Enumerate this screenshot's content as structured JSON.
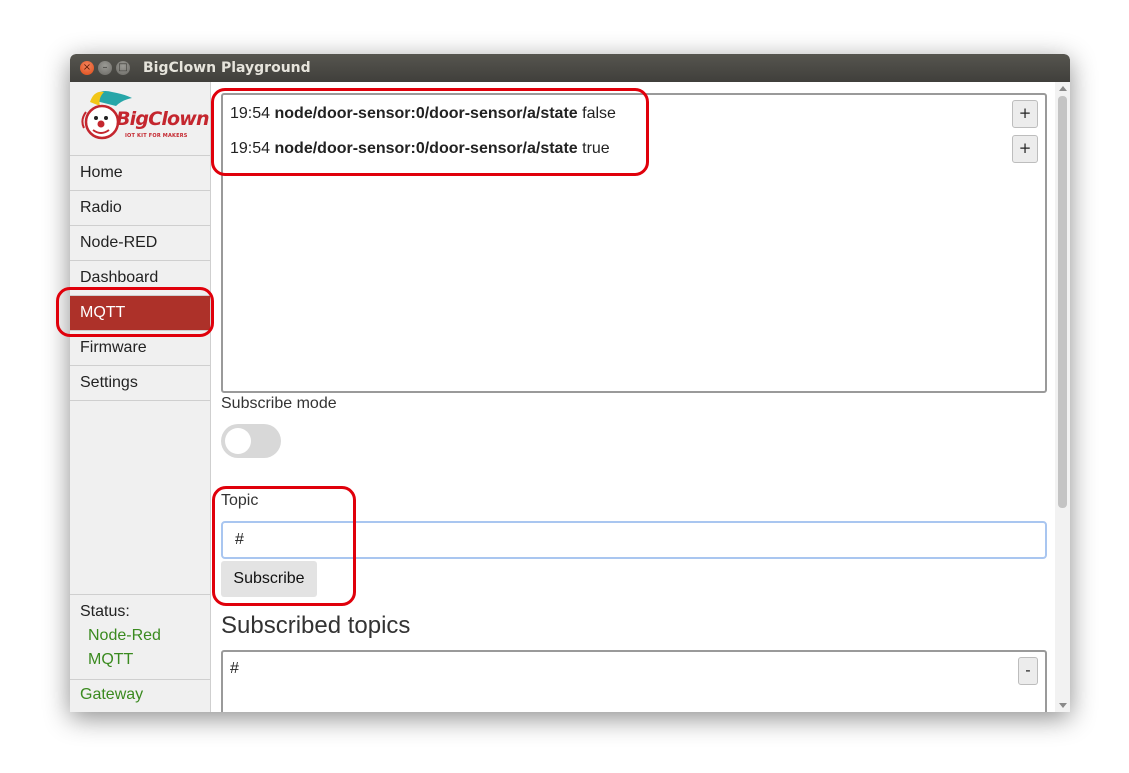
{
  "window": {
    "title": "BigClown Playground",
    "controls": {
      "close": "×",
      "minimize": "–",
      "maximize": "□"
    }
  },
  "sidebar": {
    "logo": {
      "text": "BigClown",
      "tagline": "IOT KIT FOR MAKERS"
    },
    "items": [
      {
        "label": "Home",
        "active": false
      },
      {
        "label": "Radio",
        "active": false
      },
      {
        "label": "Node-RED",
        "active": false
      },
      {
        "label": "Dashboard",
        "active": false
      },
      {
        "label": "MQTT",
        "active": true
      },
      {
        "label": "Firmware",
        "active": false
      },
      {
        "label": "Settings",
        "active": false
      }
    ],
    "status": {
      "title": "Status:",
      "items": [
        "Node-Red",
        "MQTT"
      ],
      "gateway": "Gateway"
    }
  },
  "main": {
    "messages": [
      {
        "time": "19:54",
        "topic": "node/door-sensor:0/door-sensor/a/state",
        "value": "false",
        "add_label": "+"
      },
      {
        "time": "19:54",
        "topic": "node/door-sensor:0/door-sensor/a/state",
        "value": "true",
        "add_label": "+"
      }
    ],
    "subscribe_mode_label": "Subscribe mode",
    "subscribe_mode_on": false,
    "topic_label": "Topic",
    "topic_value": "#",
    "subscribe_button": "Subscribe",
    "subscribed_heading": "Subscribed topics",
    "subscribed": [
      {
        "topic": "#",
        "remove_label": "-"
      }
    ]
  },
  "colors": {
    "accent_active": "#ad3129",
    "status_ok": "#3a8a1f",
    "highlight_annotation": "#e0000b",
    "titlebar": "#4a4945"
  }
}
